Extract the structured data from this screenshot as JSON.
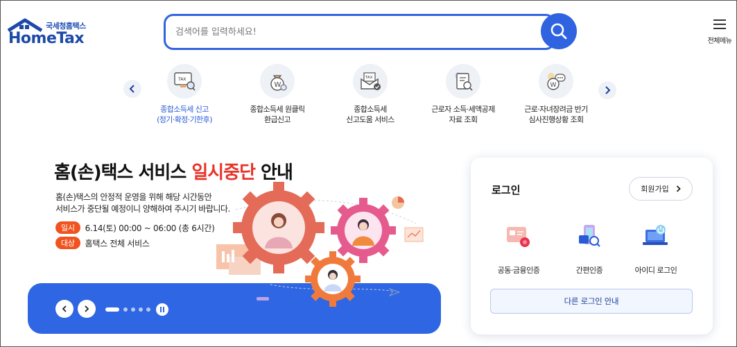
{
  "header": {
    "logo_sub": "국세청홈택스",
    "logo_main": "HomeTax",
    "search_placeholder": "검색어를 입력하세요!",
    "menu_label": "전체메뉴"
  },
  "quick_menu": {
    "items": [
      {
        "line1": "종합소득세 신고",
        "line2": "(정기·확정·기한후)",
        "icon": "tax-monitor-icon"
      },
      {
        "line1": "종합소득세 원클릭",
        "line2": "환급신고",
        "icon": "money-bag-icon"
      },
      {
        "line1": "종합소득세",
        "line2": "신고도움 서비스",
        "icon": "tax-envelope-icon"
      },
      {
        "line1": "근로자 소득·세액공제",
        "line2": "자료 조회",
        "icon": "document-search-icon"
      },
      {
        "line1": "근로·자녀장려금 반기",
        "line2": "심사진행상황 조회",
        "icon": "chat-money-icon"
      }
    ]
  },
  "banner": {
    "title_before": "홈(손)택스 서비스 ",
    "title_highlight": "일시중단",
    "title_after": " 안내",
    "desc_line1": "홈(손)택스의 안정적 운영을 위해 해당 시간동안",
    "desc_line2": "서비스가  중단될 예정이니 양해하여 주시기 바랍니다.",
    "schedule_tag": "일시",
    "schedule_text": "6.14(토) 00:00 ~ 06:00 (총 6시간)",
    "target_tag": "대상",
    "target_text": "홈택스 전체 서비스"
  },
  "login": {
    "title": "로그인",
    "signup_label": "회원가입",
    "options": [
      {
        "label": "공동·금융인증",
        "icon": "certificate-card-icon"
      },
      {
        "label": "간편인증",
        "icon": "phone-auth-icon"
      },
      {
        "label": "아이디 로그인",
        "icon": "laptop-power-icon"
      }
    ],
    "other_login_label": "다른 로그인 안내"
  },
  "colors": {
    "primary": "#2f63e0",
    "accent_red": "#e8332a",
    "tag_orange": "#f0531f",
    "banner_blue": "#2f66e3"
  }
}
